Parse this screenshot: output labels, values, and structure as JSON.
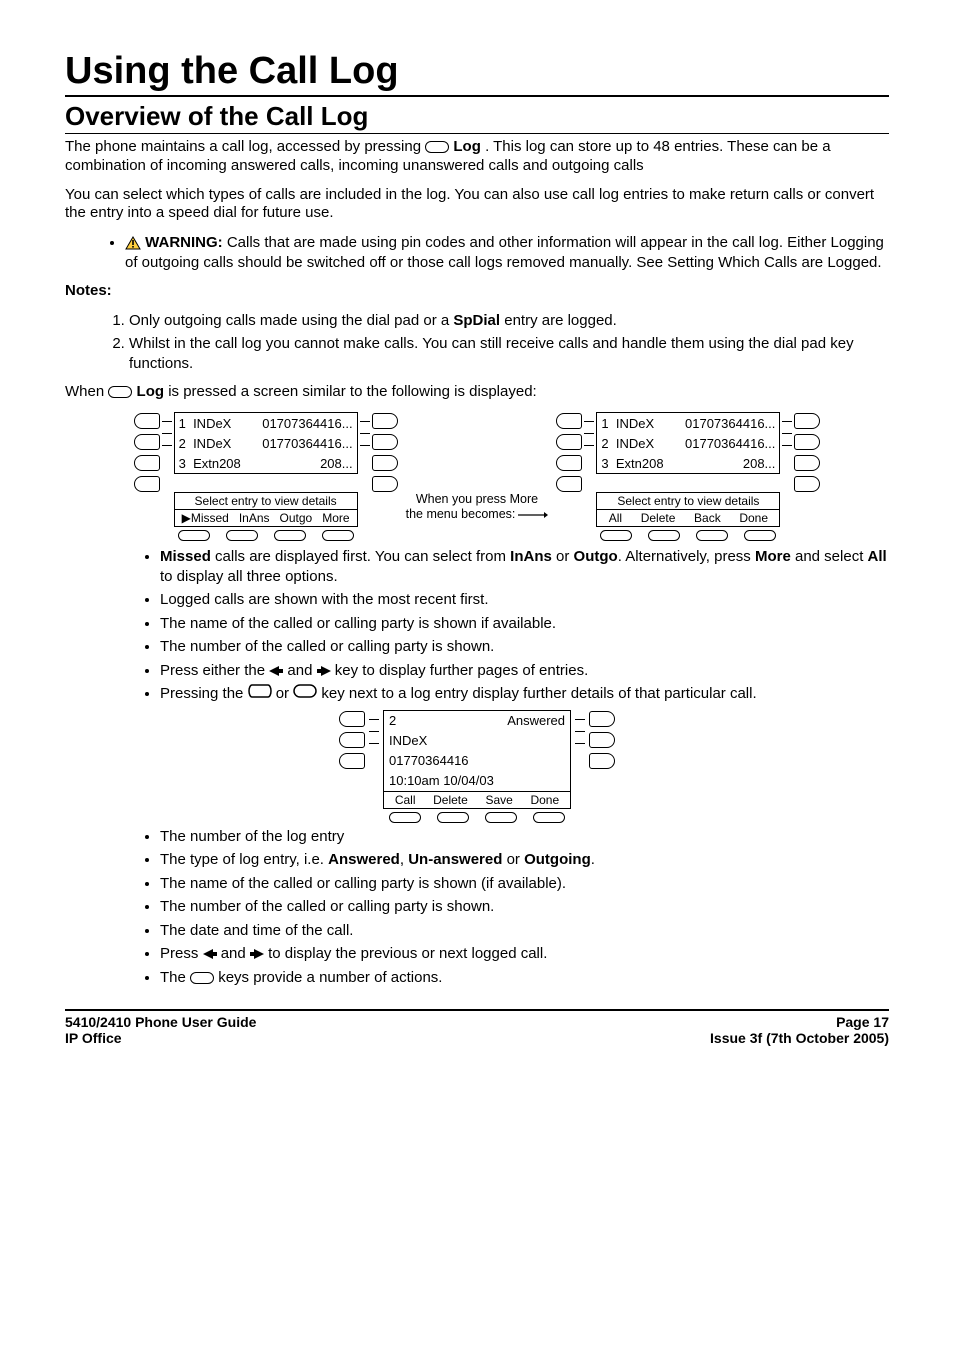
{
  "titles": {
    "h1": "Using the Call Log",
    "h2": "Overview of the Call Log"
  },
  "para": {
    "p1a": "The phone maintains a call log, accessed by pressing ",
    "p1b_label": " Log",
    "p1c": ". This log can store up to 48 entries. These can be a combination of incoming answered calls, incoming unanswered calls and outgoing calls",
    "p2": "You can select which types of calls are included in the log. You can also use call log entries to make return calls or convert the entry into a speed dial for future use.",
    "warning_label": " WARNING:",
    "warning_text": " Calls that are made using pin codes and other information will appear in the call log. Either Logging of outgoing calls should be switched off or those call logs removed manually. See Setting Which Calls are Logged.",
    "notes_label": "Notes:",
    "note1a": "Only outgoing calls made using the dial pad or a ",
    "note1b": "SpDial",
    "note1c": " entry are logged.",
    "note2": "Whilst in the call log you cannot make calls. You can still receive calls and handle them using the dial pad key functions.",
    "when_a": "When ",
    "when_b": " Log",
    "when_c": " is pressed a screen similar to the following is displayed:"
  },
  "lcd1": {
    "rows": [
      {
        "idx": "1",
        "name": "INDeX",
        "num": "01707364416..."
      },
      {
        "idx": "2",
        "name": "INDeX",
        "num": "01770364416..."
      },
      {
        "idx": "3",
        "name": "Extn208",
        "num": "208..."
      }
    ],
    "hint": "Select entry to view details",
    "menu": [
      "▶Missed",
      "InAns",
      "Outgo",
      "More"
    ]
  },
  "between": {
    "line1": "When you press More",
    "line2": "the menu becomes:"
  },
  "lcd2": {
    "rows": [
      {
        "idx": "1",
        "name": "INDeX",
        "num": "01707364416..."
      },
      {
        "idx": "2",
        "name": "INDeX",
        "num": "01770364416..."
      },
      {
        "idx": "3",
        "name": "Extn208",
        "num": "208..."
      }
    ],
    "hint": "Select entry to view details",
    "menu": [
      "All",
      "Delete",
      "Back",
      "Done"
    ]
  },
  "bullets1": {
    "b1a": "Missed",
    "b1b": " calls are displayed first. You can select from ",
    "b1c": "InAns",
    "b1d": " or ",
    "b1e": "Outgo",
    "b1f": ". Alternatively, press ",
    "b1g": "More",
    "b1h": " and select ",
    "b1i": "All",
    "b1j": " to display all three options.",
    "b2": "Logged calls are shown with the most recent first.",
    "b3": "The name of the called or calling party is shown if available.",
    "b4": "The number of the called or calling party is shown.",
    "b5a": "Press either the ",
    "b5b": " and ",
    "b5c": " key to display further pages of entries.",
    "b6a": "Pressing the ",
    "b6b": " or ",
    "b6c": " key next to a log entry display further details of that particular call."
  },
  "lcd_detail": {
    "row1_left": "2",
    "row1_right": "Answered",
    "row2": "INDeX",
    "row3": "01770364416",
    "row4": "10:10am  10/04/03",
    "menu": [
      "Call",
      "Delete",
      "Save",
      "Done"
    ]
  },
  "bullets2": {
    "b1": "The number of the log entry",
    "b2a": "The type of log entry, i.e. ",
    "b2b": "Answered",
    "b2c": ", ",
    "b2d": "Un-answered",
    "b2e": " or ",
    "b2f": "Outgoing",
    "b2g": ".",
    "b3": "The name of the called or calling party is shown (if available).",
    "b4": "The number of the called or calling party is shown.",
    "b5": "The date and time of the call.",
    "b6a": "Press ",
    "b6b": " and ",
    "b6c": " to display the previous or next logged call.",
    "b7a": "The ",
    "b7b": " keys provide a number of actions."
  },
  "footer": {
    "left1": "5410/2410 Phone User Guide",
    "left2": "IP Office",
    "right1": "Page 17",
    "right2": "Issue 3f (7th October 2005)"
  }
}
